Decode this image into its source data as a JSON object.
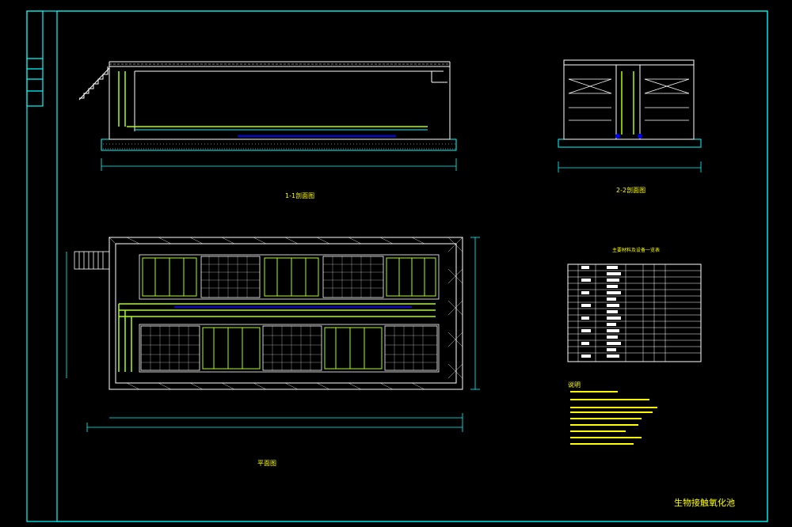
{
  "drawing": {
    "title_block": "生物接触氧化池",
    "views": {
      "section_1_1": {
        "label": "1-1剖面图"
      },
      "section_2_2": {
        "label": "2-2剖面图"
      },
      "plan": {
        "label": "平面图"
      }
    },
    "material_table": {
      "title": "主要材料及设备一览表"
    },
    "notes": {
      "heading": "说明"
    },
    "colors": {
      "background": "#000000",
      "frame": "#00ffff",
      "structure": "#ffffff",
      "pipe": "#aaff00",
      "blue_pipe": "#0000ff",
      "title": "#ffff00",
      "label": "#ffff00"
    }
  }
}
